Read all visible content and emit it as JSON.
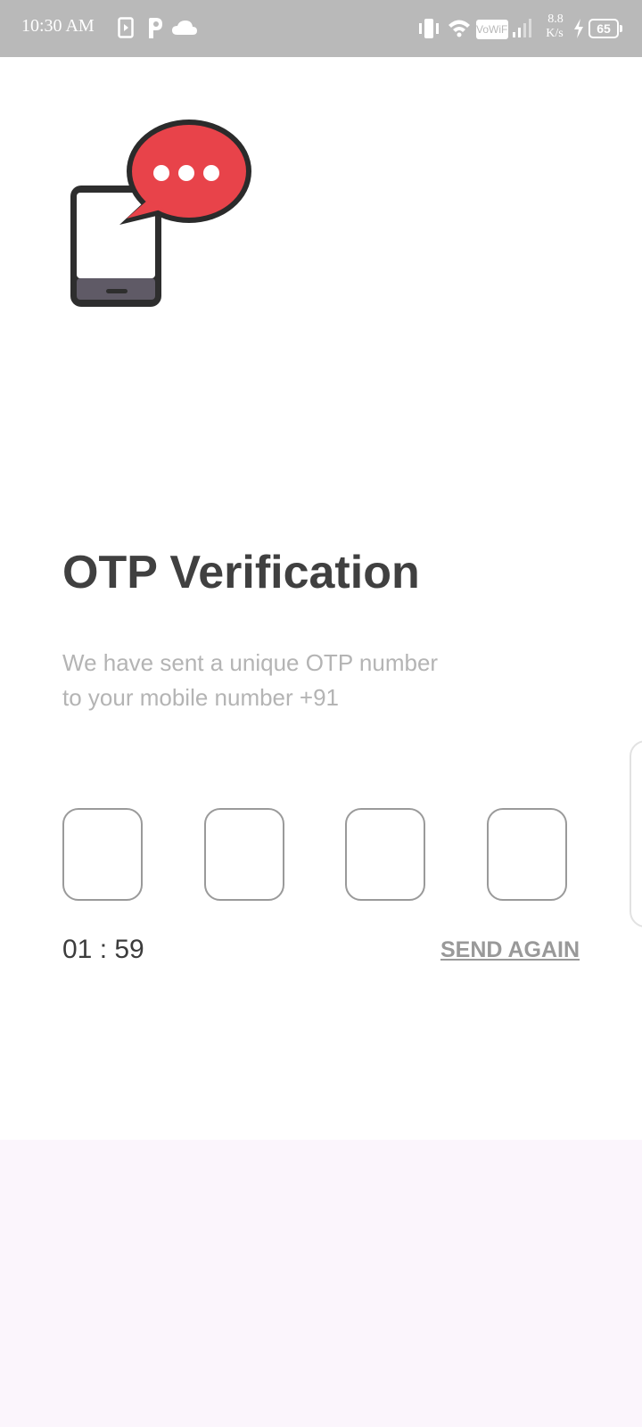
{
  "status_bar": {
    "time": "10:30 AM",
    "network_speed_value": "8.8",
    "network_speed_unit": "K/s",
    "battery": "65",
    "vowifi": "VoWiFi",
    "left_icons": [
      "media-icon",
      "parking-app-icon",
      "cloud-icon"
    ],
    "right_icons": [
      "vibrate-icon",
      "wifi-icon",
      "vowifi-icon",
      "signal-icon",
      "charging-icon",
      "battery-icon"
    ]
  },
  "hero": {
    "icon": "phone-message-icon",
    "bubble_color": "#e8434a",
    "phone_color": "#2e2e2e"
  },
  "content": {
    "title": "OTP Verification",
    "subtitle_line1": "We have sent a unique OTP number",
    "subtitle_line2": "to your mobile number +91"
  },
  "otp": {
    "digits": [
      "",
      "",
      "",
      ""
    ]
  },
  "timer": "01 : 59",
  "send_again_label": "SEND AGAIN",
  "colors": {
    "status_bar_bg": "#b9b9b9",
    "title": "#404040",
    "subtitle": "#b4b4b4",
    "link": "#999999",
    "bottom_bg": "#fbf5fc"
  }
}
